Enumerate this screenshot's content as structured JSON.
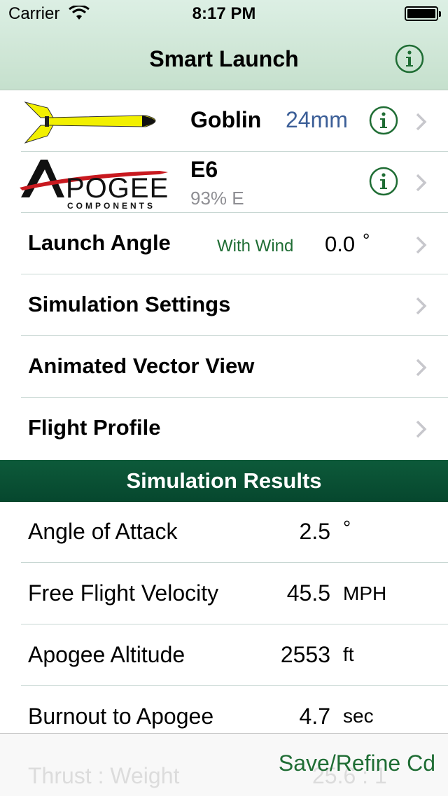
{
  "status_bar": {
    "carrier": "Carrier",
    "time": "8:17 PM"
  },
  "nav": {
    "title": "Smart Launch"
  },
  "rocket_row": {
    "name": "Goblin",
    "size": "24mm"
  },
  "motor_row": {
    "brand_logo_text": "Apogee",
    "brand_logo_subtext": "COMPONENTS",
    "name": "E6",
    "detail": "93% E"
  },
  "launch_angle_row": {
    "label": "Launch Angle",
    "mode": "With Wind",
    "value": "0.0",
    "unit": "°"
  },
  "menu_rows": [
    {
      "label": "Simulation Settings"
    },
    {
      "label": "Animated Vector View"
    },
    {
      "label": "Flight Profile"
    }
  ],
  "results": {
    "header": "Simulation Results",
    "rows": [
      {
        "label": "Angle of Attack",
        "value": "2.5",
        "unit": "°"
      },
      {
        "label": "Free Flight Velocity",
        "value": "45.5",
        "unit": "MPH"
      },
      {
        "label": "Apogee Altitude",
        "value": "2553",
        "unit": "ft"
      },
      {
        "label": "Burnout to Apogee",
        "value": "4.7",
        "unit": "sec"
      }
    ],
    "partial_row": {
      "label": "Thrust : Weight",
      "value": "25.6 : 1"
    }
  },
  "toolbar": {
    "save_label": "Save/Refine Cd"
  },
  "colors": {
    "accent_green": "#1f6d34",
    "header_green": "#0d5a3a",
    "size_blue": "#3b5e97"
  }
}
